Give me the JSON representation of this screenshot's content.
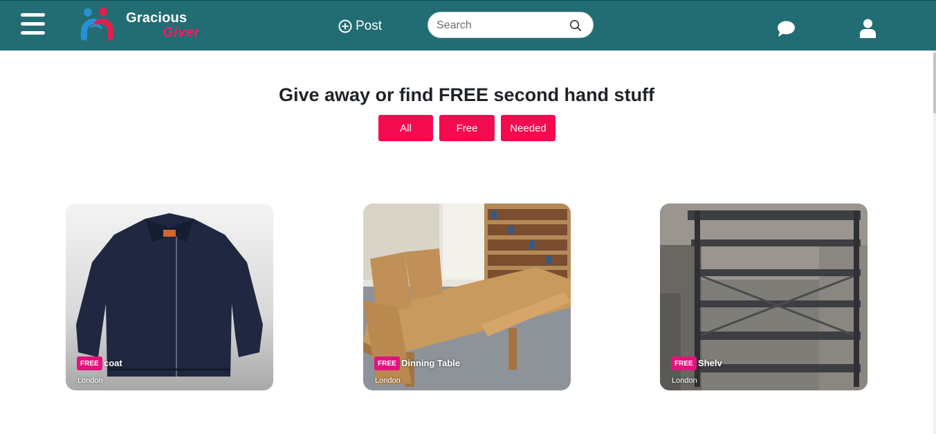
{
  "header": {
    "logo_line1": "Gracious",
    "logo_line2": "Giver",
    "post_label": "Post",
    "search_placeholder": "Search"
  },
  "main": {
    "heading": "Give away or find FREE second hand stuff",
    "filters": [
      "All",
      "Free",
      "Needed"
    ]
  },
  "listings": [
    {
      "badge": "FREE",
      "title": "coat",
      "location": "London"
    },
    {
      "badge": "FREE",
      "title": "Dinning Table",
      "location": "London"
    },
    {
      "badge": "FREE",
      "title": "Shelv",
      "location": "London"
    }
  ],
  "colors": {
    "navbar": "#216d73",
    "accent": "#f50a50",
    "badge": "#e5127d"
  }
}
